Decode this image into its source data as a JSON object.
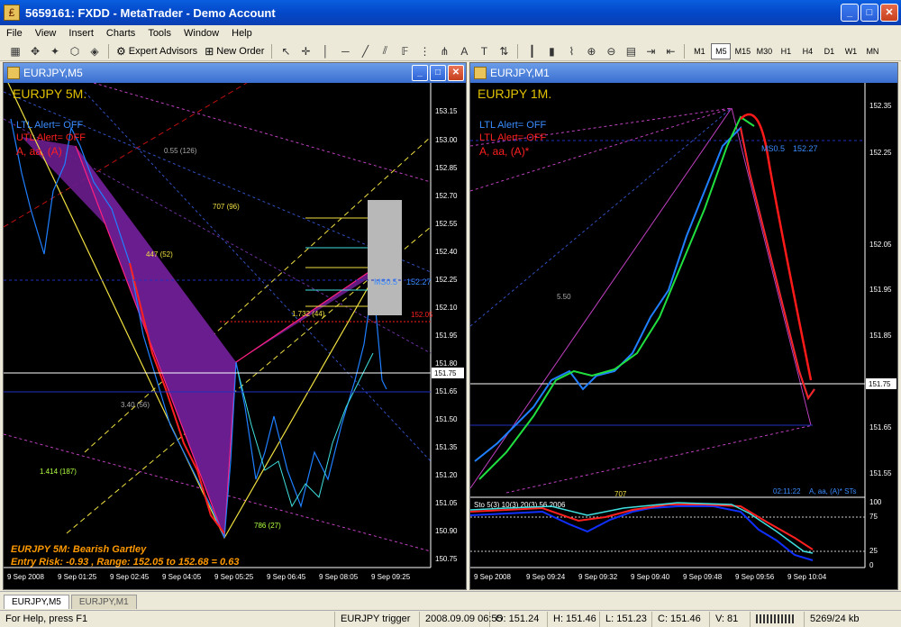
{
  "window": {
    "title": "5659161: FXDD - MetaTrader - Demo Account",
    "app_icon": "metatrader-icon",
    "minimize": "_",
    "maximize": "□",
    "close": "✕"
  },
  "menu": [
    "File",
    "View",
    "Insert",
    "Charts",
    "Tools",
    "Window",
    "Help"
  ],
  "toolbar": {
    "expert_advisors": "Expert Advisors",
    "new_order": "New Order",
    "text_tool": "A",
    "label_tool": "T",
    "timeframes": [
      "M1",
      "M5",
      "M15",
      "M30",
      "H1",
      "H4",
      "D1",
      "W1",
      "MN"
    ],
    "active_timeframe": "M5"
  },
  "charts": [
    {
      "title": "EURJPY,M5",
      "headline": "EURJPY 5M.",
      "ltl_alert": "LTL Alert= OFF",
      "utl_alert": "UTL Alert= OFF",
      "wave_label": "A, aa, (A)",
      "price_axis": [
        "153.15",
        "153.00",
        "152.85",
        "152.70",
        "152.55",
        "152.40",
        "152.25",
        "152.10",
        "151.95",
        "151.80",
        "151.65",
        "151.50",
        "151.35",
        "151.20",
        "151.05",
        "150.90",
        "150.75"
      ],
      "current_price": "151.75",
      "time_axis": [
        "9 Sep 2008",
        "9 Sep 01:25",
        "9 Sep 02:45",
        "9 Sep 04:05",
        "9 Sep 05:25",
        "9 Sep 06:45",
        "9 Sep 08:05",
        "9 Sep 09:25"
      ],
      "fib_labels": {
        "f055": "0.55 (126)",
        "f707": "707 (96)",
        "f447": "447 (52)",
        "f1732": "1.732 (44)",
        "f340": "3.40 (56)",
        "f1414": "1.414 (187)",
        "f786": "786 (27)",
        "ms05": "MS0.5",
        "ms_price": "152.27",
        "target": "152.05"
      },
      "annotation_line1": "EURJPY 5M: Bearish Gartley",
      "annotation_line2": "Entry Risk: -0.93 , Range: 152.05 to 152.68 = 0.63",
      "colors": {
        "bull": "#1f7fff",
        "bear": "#ff1a1a",
        "pattern": "#7a1f9a",
        "annotation": "#ff9900",
        "headline": "#e0c000"
      }
    },
    {
      "title": "EURJPY,M1",
      "headline": "EURJPY 1M.",
      "ltl_alert": "LTL Alert= OFF",
      "utl_alert": "LTL Alert= OFF",
      "wave_label": "A, aa, (A)*",
      "price_axis": [
        "152.35",
        "152.25",
        "152.05",
        "151.95",
        "151.85",
        "151.75",
        "151.65",
        "151.55"
      ],
      "current_price": "151.75",
      "time_axis": [
        "9 Sep 2008",
        "9 Sep 09:24",
        "9 Sep 09:32",
        "9 Sep 09:40",
        "9 Sep 09:48",
        "9 Sep 09:56",
        "9 Sep 10:04"
      ],
      "fib_labels": {
        "f550": "5.50",
        "ms05": "MS0.5",
        "ms_price": "152.27",
        "f707": "707"
      },
      "time_label": "02:11:22",
      "wave_tag": "A, aa, (A)* STs",
      "stoch_label": "Sto 5(3) 10(3) 20(3) 56.2006",
      "stoch_axis": [
        "100",
        "75",
        "25",
        "0"
      ]
    }
  ],
  "tabs": [
    "EURJPY,M5",
    "EURJPY,M1"
  ],
  "active_tab": "EURJPY,M5",
  "status": {
    "help": "For Help, press F1",
    "profile": "EURJPY trigger",
    "datetime": "2008.09.09 06:55",
    "open": "O: 151.24",
    "high": "H: 151.46",
    "low": "L: 151.23",
    "close": "C: 151.46",
    "volume": "V: 81",
    "traffic": "5269/24 kb"
  }
}
